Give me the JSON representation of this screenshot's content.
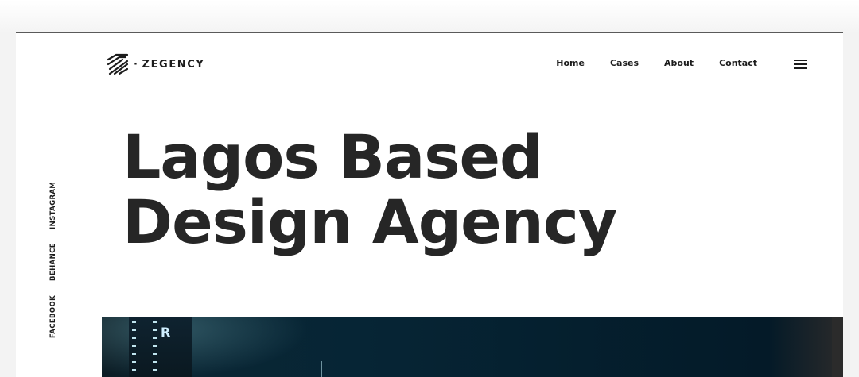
{
  "brand": {
    "name": "ZEGENCY",
    "separator": "·"
  },
  "nav": {
    "items": [
      {
        "label": "Home"
      },
      {
        "label": "Cases"
      },
      {
        "label": "About"
      },
      {
        "label": "Contact"
      }
    ],
    "menu_icon": "hamburger-menu-icon"
  },
  "hero": {
    "title_line1": "Lagos Based",
    "title_line2": "Design Agency"
  },
  "social": {
    "items": [
      {
        "label": "INSTAGRAM"
      },
      {
        "label": "BEHANCE"
      },
      {
        "label": "FACEBOOK"
      }
    ]
  },
  "image": {
    "building_sign": "R"
  },
  "colors": {
    "text": "#1c1c1c",
    "headline": "#262626",
    "background": "#ffffff",
    "image_dark": "#05202f"
  }
}
